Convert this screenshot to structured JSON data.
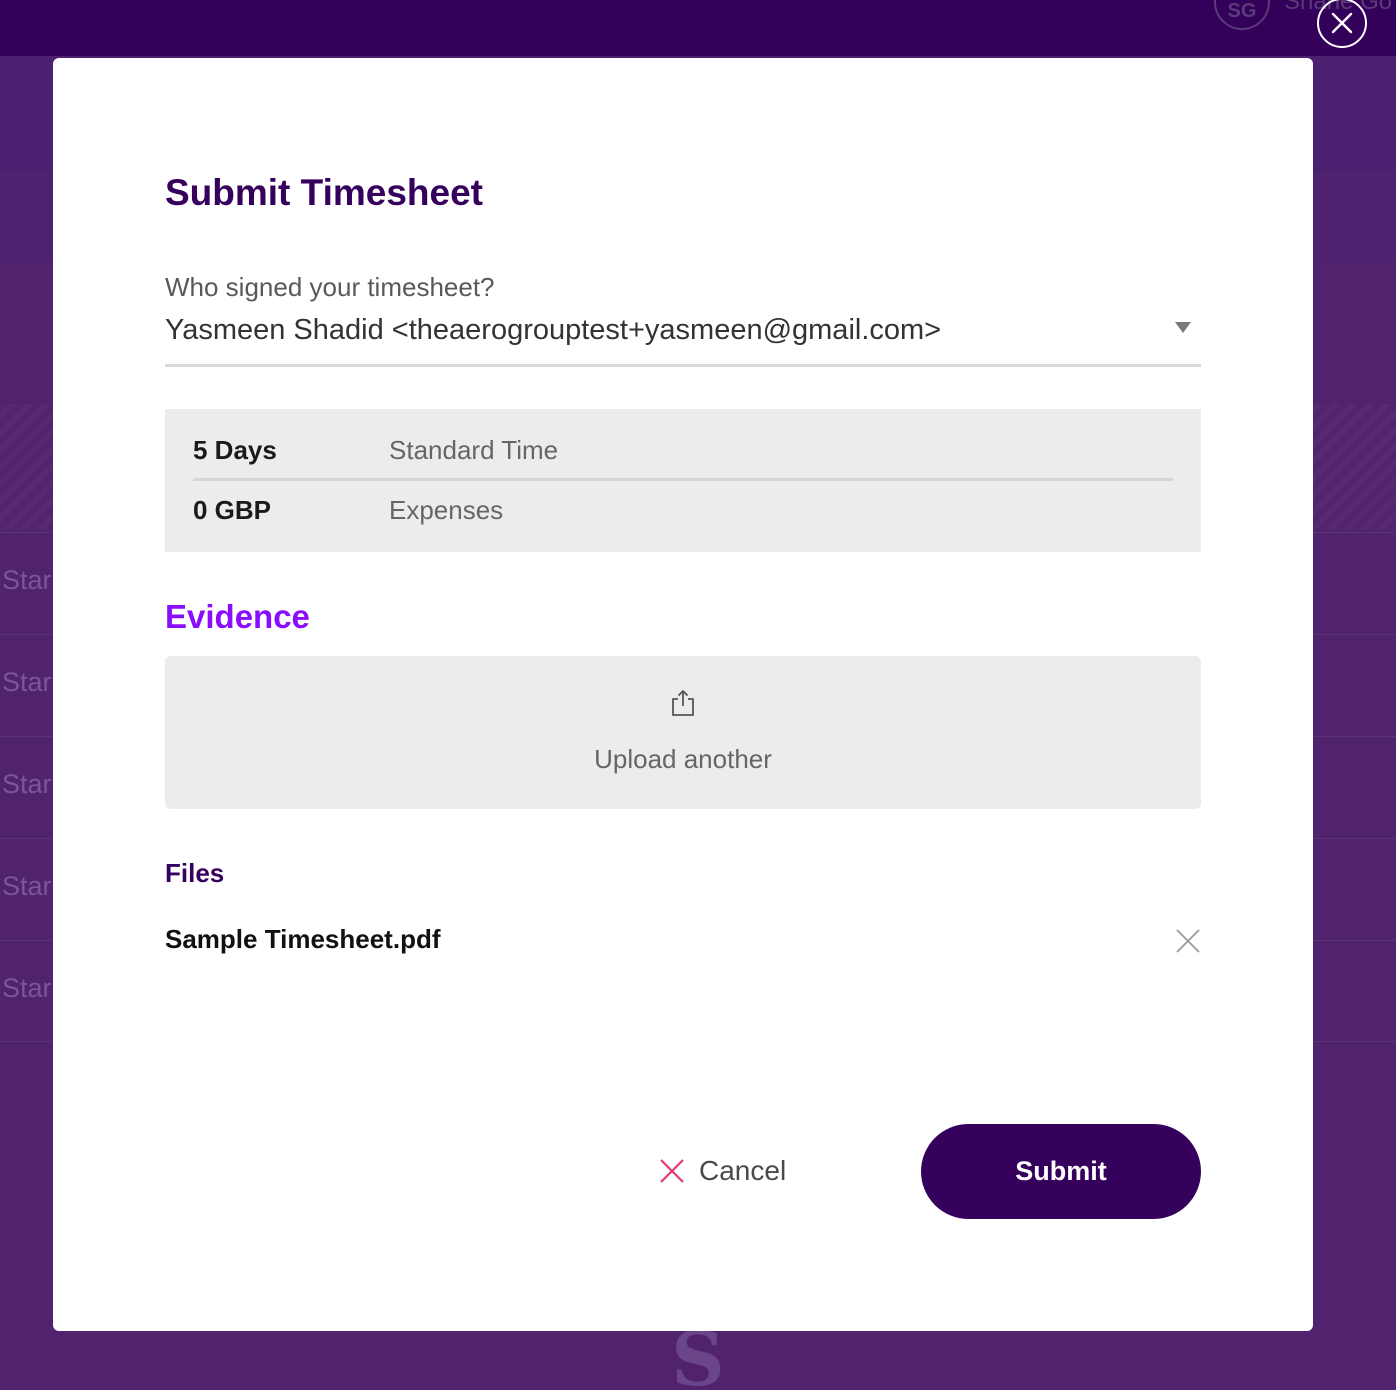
{
  "background": {
    "avatar_initials": "SG",
    "user_name": "Shane Go",
    "row_label": "Star",
    "rows": [
      {
        "label": "Star"
      },
      {
        "label": "Star"
      },
      {
        "label": "Star"
      },
      {
        "label": "Star"
      },
      {
        "label": "Star"
      }
    ],
    "logo_glyph": "S"
  },
  "overlay": {
    "close_icon": "close-circle-icon"
  },
  "modal": {
    "title": "Submit Timesheet",
    "signer": {
      "label": "Who signed your timesheet?",
      "value": "Yasmeen Shadid <theaerogrouptest+yasmeen@gmail.com>",
      "caret_icon": "caret-down-icon"
    },
    "summary": [
      {
        "value": "5 Days",
        "name": "Standard Time"
      },
      {
        "value": "0 GBP",
        "name": "Expenses"
      }
    ],
    "evidence": {
      "title": "Evidence",
      "upload_label": "Upload another",
      "upload_icon": "share-upload-icon"
    },
    "files": {
      "title": "Files",
      "items": [
        {
          "name": "Sample Timesheet.pdf"
        }
      ]
    },
    "actions": {
      "cancel_label": "Cancel",
      "submit_label": "Submit"
    }
  },
  "colors": {
    "brand_dark": "#36005d",
    "accent_purple": "#8a0dff",
    "cancel_red": "#e8336b",
    "panel_gray": "#ececec"
  }
}
